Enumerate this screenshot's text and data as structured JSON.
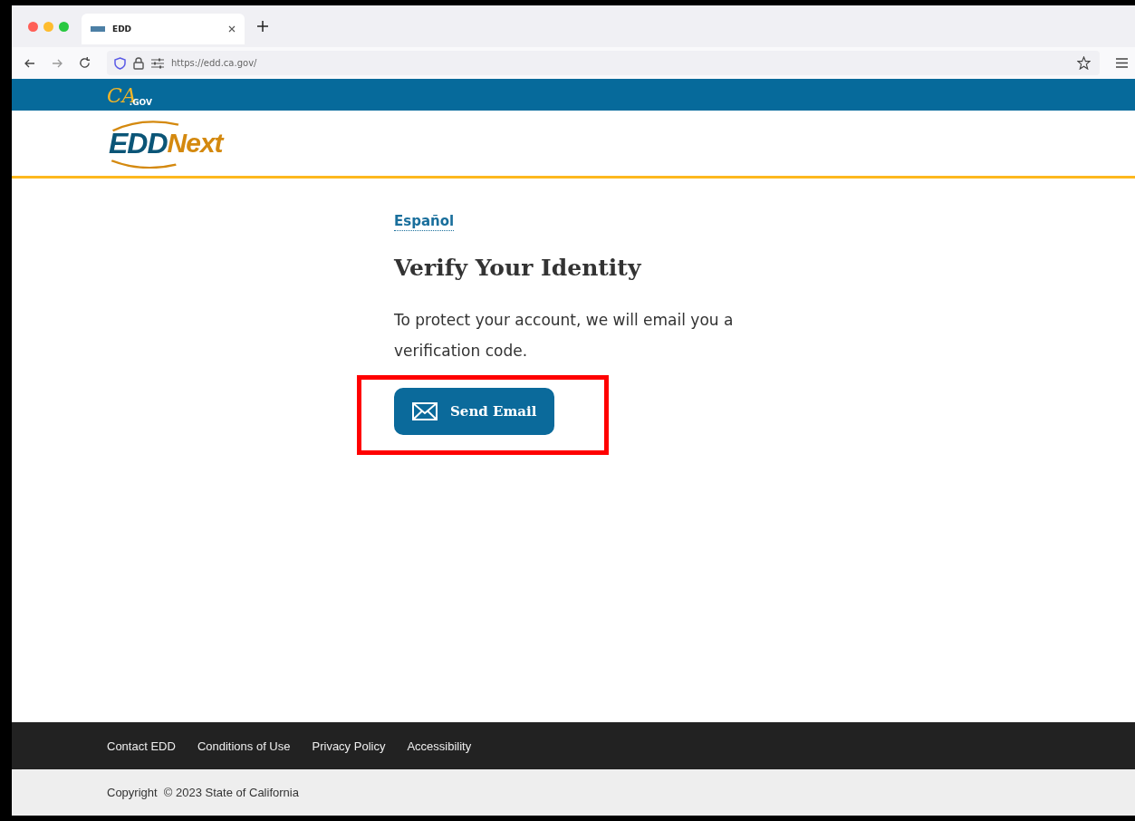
{
  "browser": {
    "tab_title": "EDD",
    "url": "https://edd.ca.gov/"
  },
  "banner": {
    "logo_main": "CA",
    "logo_sub": ".GOV"
  },
  "header": {
    "logo_first": "EDD",
    "logo_second": "Next"
  },
  "language_link": "Español",
  "heading": "Verify Your Identity",
  "message": "To protect your account, we will email you a verification code.",
  "send_button": "Send Email",
  "highlighted": true,
  "footer": {
    "links": [
      "Contact EDD",
      "Conditions of Use",
      "Privacy Policy",
      "Accessibility"
    ],
    "copyright": "Copyright  © 2023 State of California"
  }
}
